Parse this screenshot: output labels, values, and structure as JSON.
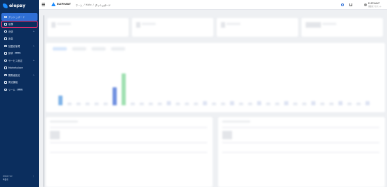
{
  "app": {
    "logo_text": "elepay"
  },
  "sidebar": {
    "items": [
      {
        "label": "ダッシュボード",
        "icon": "dashboard-icon",
        "active": true
      },
      {
        "label": "店舗",
        "icon": "store-icon",
        "highlighted": true
      },
      {
        "label": "決済",
        "icon": "payment-icon",
        "chevron": "+"
      },
      {
        "label": "返金",
        "icon": "refund-icon"
      },
      {
        "label": "加盟店管理",
        "icon": "merchant-icon",
        "chevron": "+"
      },
      {
        "label": "請求",
        "icon": "invoice-icon",
        "tag": "NEW"
      },
      {
        "label": "サービス設定",
        "icon": "settings-icon",
        "chevron": "+"
      },
      {
        "label": "Marketplace",
        "icon": "marketplace-icon"
      },
      {
        "label": "開発者設定",
        "icon": "developer-icon",
        "chevron": "+"
      },
      {
        "label": "周辺機能",
        "icon": "peripheral-icon"
      },
      {
        "label": "ツール",
        "icon": "tool-icon",
        "tag": "NEW"
      }
    ],
    "footer": {
      "line1": "elepay ver.",
      "line2": "事業者",
      "option": "⋮"
    }
  },
  "header": {
    "brand_name": "ELEPHANT",
    "breadcrumbs": [
      "ホーム",
      "Kaito",
      "ダッシュボード"
    ]
  },
  "user": {
    "name": "ELEPHANT",
    "sub": "事業者アカウント"
  },
  "colors": {
    "sidebar_bg": "#0b2e5e",
    "active_item": "#2f6fd6",
    "highlight_outline": "#ff2d6f",
    "brand_blue": "#1c8cff"
  }
}
